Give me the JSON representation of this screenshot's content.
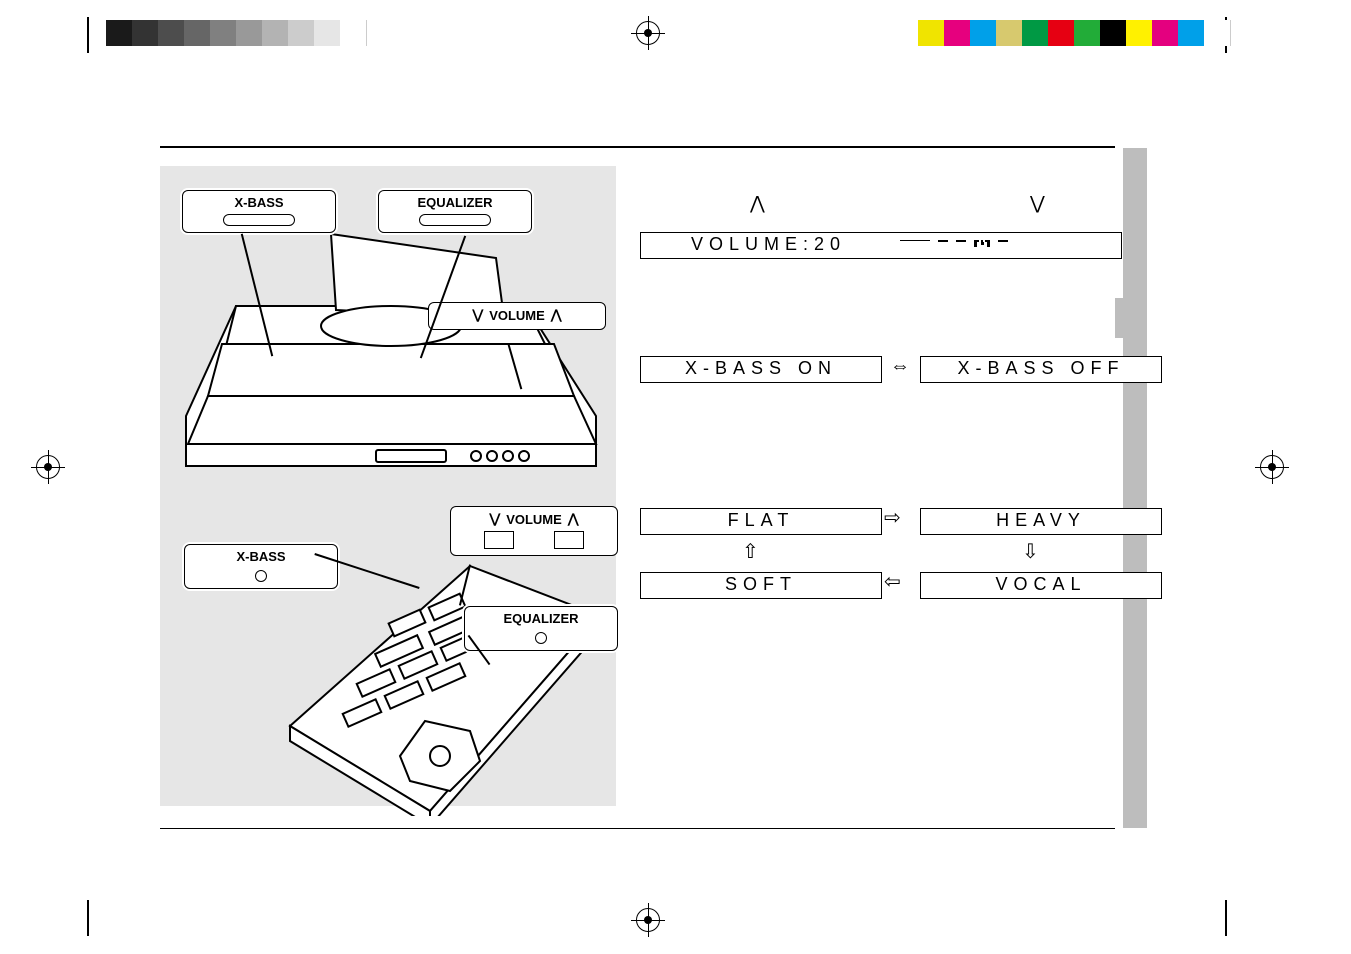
{
  "labels": {
    "xbass": "X-BASS",
    "equalizer": "EQUALIZER",
    "volume": "VOLUME"
  },
  "volume_display": "VOLUME:20",
  "xbass_toggle": {
    "on": "X-BASS ON",
    "off": "X-BASS OFF"
  },
  "eq_modes": {
    "flat": "FLAT",
    "heavy": "HEAVY",
    "soft": "SOFT",
    "vocal": "VOCAL"
  },
  "cal": {
    "gray": [
      "#1a1a1a",
      "#333333",
      "#4d4d4d",
      "#666666",
      "#808080",
      "#999999",
      "#b3b3b3",
      "#cccccc",
      "#e6e6e6",
      "#ffffff"
    ],
    "color": [
      "#f0e400",
      "#e6007e",
      "#00a0e9",
      "#d7c96e",
      "#009944",
      "#e60012",
      "#22ac38",
      "#000000",
      "#fff100",
      "#e4007f",
      "#00a0e9",
      "#ffffff"
    ]
  }
}
